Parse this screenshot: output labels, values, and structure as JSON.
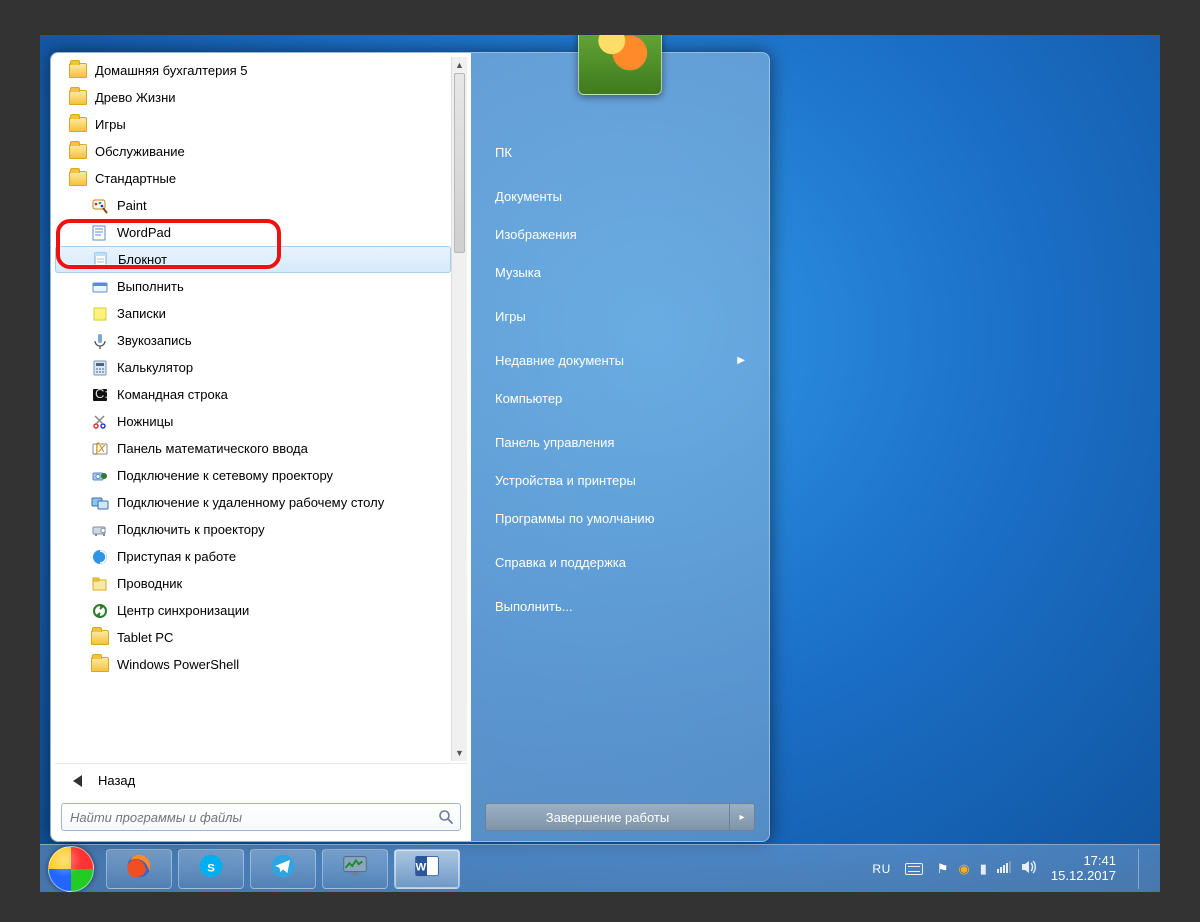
{
  "programs": {
    "folders_top": [
      "Домашняя бухгалтерия 5",
      "Древо Жизни",
      "Игры",
      "Обслуживание",
      "Стандартные"
    ],
    "accessories": [
      {
        "label": "Paint",
        "icon": "paint"
      },
      {
        "label": "WordPad",
        "icon": "wordpad"
      },
      {
        "label": "Блокнот",
        "icon": "notepad",
        "highlight": true
      },
      {
        "label": "Выполнить",
        "icon": "run"
      },
      {
        "label": "Записки",
        "icon": "sticky"
      },
      {
        "label": "Звукозапись",
        "icon": "soundrec"
      },
      {
        "label": "Калькулятор",
        "icon": "calc"
      },
      {
        "label": "Командная строка",
        "icon": "cmd"
      },
      {
        "label": "Ножницы",
        "icon": "snip"
      },
      {
        "label": "Панель математического ввода",
        "icon": "mathinput"
      },
      {
        "label": "Подключение к сетевому проектору",
        "icon": "netproj"
      },
      {
        "label": "Подключение к удаленному рабочему столу",
        "icon": "rdp"
      },
      {
        "label": "Подключить к проектору",
        "icon": "proj"
      },
      {
        "label": "Приступая к работе",
        "icon": "getting"
      },
      {
        "label": "Проводник",
        "icon": "explorer"
      },
      {
        "label": "Центр синхронизации",
        "icon": "sync"
      }
    ],
    "folders_bottom": [
      "Tablet PC",
      "Windows PowerShell"
    ],
    "back_label": "Назад",
    "search_placeholder": "Найти программы и файлы"
  },
  "right_pane": {
    "items": [
      {
        "label": "ПК"
      },
      {
        "label": "Документы"
      },
      {
        "label": "Изображения"
      },
      {
        "label": "Музыка"
      },
      {
        "label": "Игры"
      },
      {
        "label": "Недавние документы",
        "submenu": true
      },
      {
        "label": "Компьютер"
      },
      {
        "label": "Панель управления"
      },
      {
        "label": "Устройства и принтеры"
      },
      {
        "label": "Программы по умолчанию"
      },
      {
        "label": "Справка и поддержка"
      },
      {
        "label": "Выполнить..."
      }
    ],
    "shutdown_label": "Завершение работы"
  },
  "tray": {
    "language": "RU",
    "time": "17:41",
    "date": "15.12.2017"
  }
}
